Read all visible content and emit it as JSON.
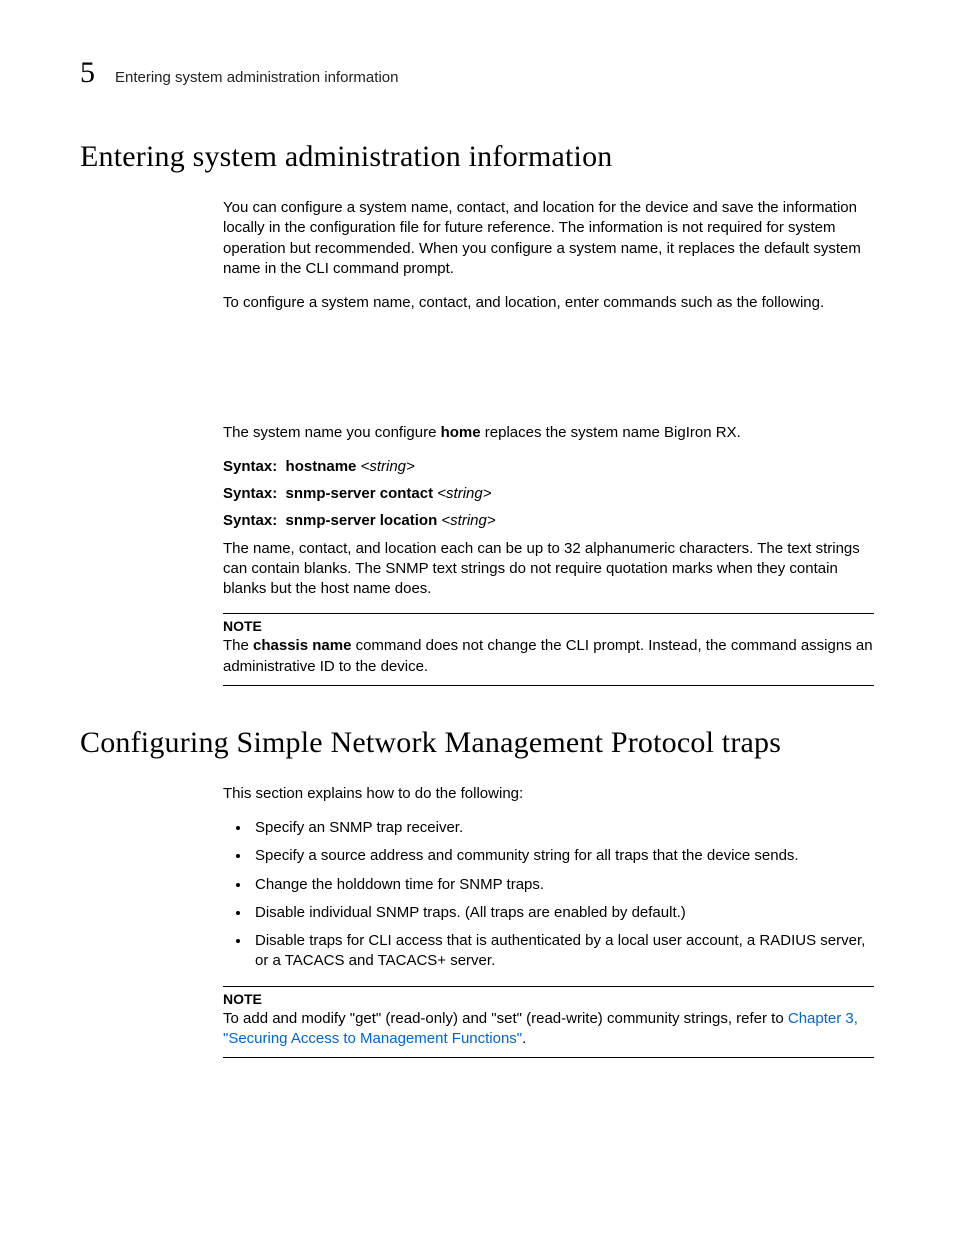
{
  "header": {
    "chapter_number": "5",
    "running_title": "Entering system administration information"
  },
  "section1": {
    "heading": "Entering system administration information",
    "para1": "You can configure a system name, contact, and location for the device and save the information locally in the configuration file for future reference. The information is not required for system operation but recommended. When you configure a system name, it replaces the default system name in the CLI command prompt.",
    "para2": "To configure a system name, contact, and location, enter commands such as the following.",
    "para3_a": "The system name you configure ",
    "para3_bold": "home",
    "para3_b": " replaces the system name BigIron RX.",
    "syntax_label": "Syntax:",
    "syntax1_cmd": "hostname",
    "syntax1_arg": "<string>",
    "syntax2_cmd": "snmp-server contact",
    "syntax2_arg": "<string>",
    "syntax3_cmd": "snmp-server location",
    "syntax3_arg": "<string>",
    "para4": "The name, contact, and location each can be up to 32 alphanumeric characters. The text strings can contain blanks.  The SNMP text strings do not require quotation marks when they contain blanks but the host name does.",
    "note1_label": "NOTE",
    "note1_a": "The ",
    "note1_bold": "chassis name",
    "note1_b": " command does not change the CLI prompt.  Instead, the command assigns an administrative ID to the device."
  },
  "section2": {
    "heading": "Configuring Simple Network Management Protocol traps",
    "intro": "This section explains how to do the following:",
    "bullets": [
      "Specify an SNMP trap receiver.",
      "Specify a source address and community string for all traps that the device sends.",
      "Change the holddown time for SNMP traps.",
      "Disable individual SNMP traps. (All traps are enabled by default.)",
      "Disable traps for CLI access that is authenticated by a local user account, a RADIUS server, or a TACACS and TACACS+ server."
    ],
    "note2_label": "NOTE",
    "note2_a": "To add and modify \"get\" (read-only) and \"set\" (read-write) community strings, refer to ",
    "note2_link": "Chapter 3, \"Securing Access to Management Functions\"",
    "note2_b": "."
  }
}
